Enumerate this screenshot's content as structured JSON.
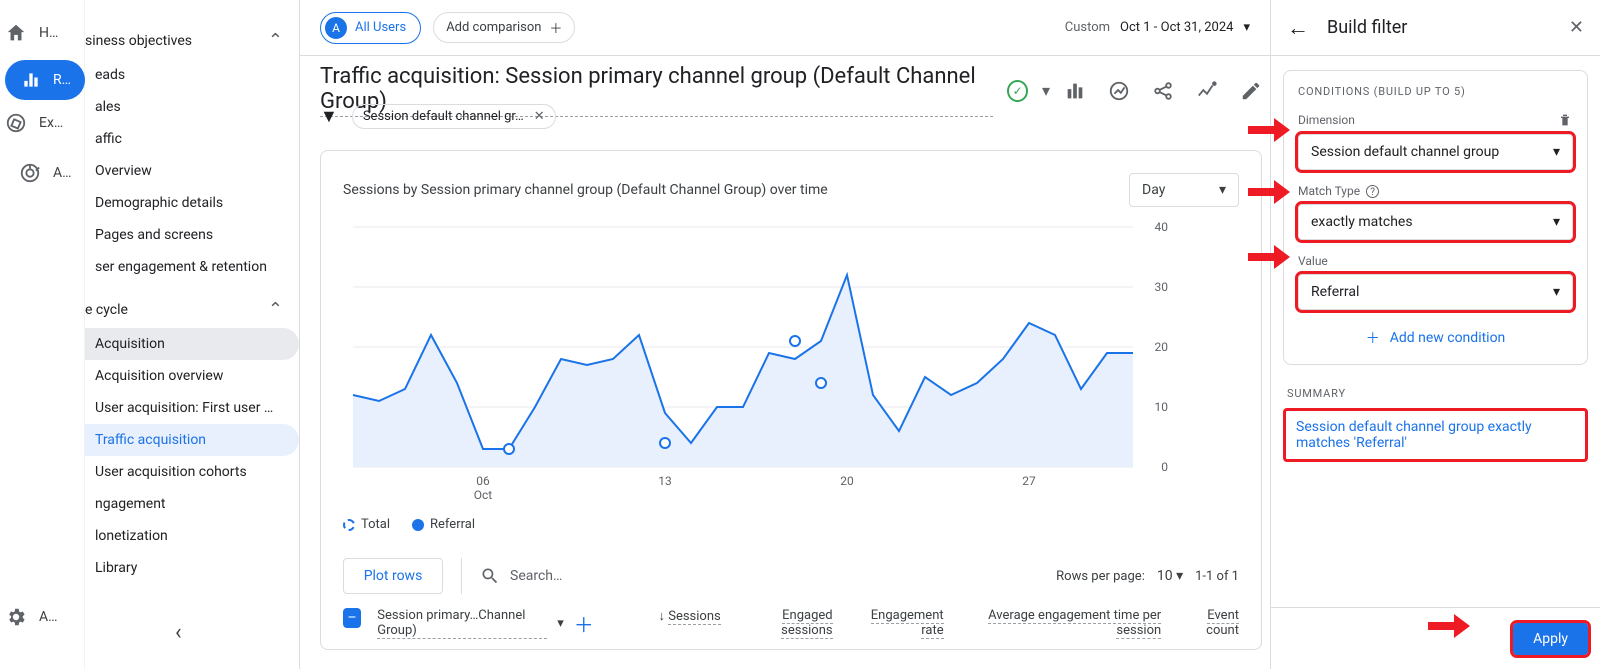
{
  "rail": {
    "home": "H…",
    "reports": "R…",
    "explore": "Ex…",
    "advertising": "A…",
    "admin": "A…"
  },
  "sidenav": {
    "heading": "siness objectives",
    "items": [
      "eads",
      "ales",
      "affic"
    ],
    "traffic_children": [
      "Overview",
      "Demographic details",
      "Pages and screens"
    ],
    "engagement_ret": "ser engagement & retention",
    "cycle": "e cycle",
    "acquisition": "Acquisition",
    "acq_children": [
      "Acquisition overview",
      "User acquisition: First user …",
      "Traffic acquisition",
      "User acquisition cohorts"
    ],
    "bottom": [
      "ngagement",
      "lonetization",
      "Library"
    ]
  },
  "topbar": {
    "allusers": "All Users",
    "addcomp": "Add comparison",
    "custom": "Custom",
    "date": "Oct 1 - Oct 31, 2024"
  },
  "header": {
    "title": "Traffic acquisition: Session primary channel group (Default Channel Group)",
    "chip": "Session default channel gr…"
  },
  "card": {
    "title": "Sessions by Session primary channel group (Default Channel Group) over time",
    "granularity": "Day",
    "legend_total": "Total",
    "legend_referral": "Referral",
    "y_ticks": [
      "40",
      "30",
      "20",
      "10",
      "0"
    ],
    "x_ticks": [
      "06",
      "13",
      "20",
      "27"
    ],
    "x_month": "Oct",
    "plot_rows": "Plot rows",
    "search_ph": "Search…",
    "rpp_label": "Rows per page:",
    "rpp_value": "10",
    "page_label": "1-1 of 1",
    "col_dim": "Session primary…Channel Group)",
    "cols": [
      "Sessions",
      "Engaged sessions",
      "Engagement rate",
      "Average engagement time per session",
      "Event count"
    ]
  },
  "panel": {
    "title": "Build filter",
    "cond_h": "CONDITIONS (BUILD UP TO 5)",
    "dim_l": "Dimension",
    "dim_v": "Session default channel group",
    "mt_l": "Match Type",
    "mt_v": "exactly matches",
    "val_l": "Value",
    "val_v": "Referral",
    "add": "Add new condition",
    "sum_h": "SUMMARY",
    "sum_v": "Session default channel group exactly matches 'Referral'",
    "apply": "Apply"
  },
  "chart_data": {
    "type": "area",
    "xlabel": "Oct",
    "ylabel": "",
    "ylim": [
      0,
      40
    ],
    "x": [
      1,
      2,
      3,
      4,
      5,
      6,
      7,
      8,
      9,
      10,
      11,
      12,
      13,
      14,
      15,
      16,
      17,
      18,
      19,
      20,
      21,
      22,
      23,
      24,
      25,
      26,
      27,
      28,
      29,
      30,
      31
    ],
    "series": [
      {
        "name": "Referral",
        "values": [
          12,
          11,
          13,
          22,
          14,
          3,
          3,
          10,
          18,
          17,
          18,
          22,
          9,
          4,
          10,
          10,
          19,
          18,
          21,
          32,
          12,
          6,
          15,
          12,
          14,
          18,
          24,
          22,
          13,
          19,
          19
        ]
      }
    ],
    "markers": [
      {
        "x": 7,
        "y": 3
      },
      {
        "x": 13,
        "y": 4
      },
      {
        "x": 18,
        "y": 21
      },
      {
        "x": 19,
        "y": 14
      }
    ],
    "x_tick_labels": [
      "06",
      "13",
      "20",
      "27"
    ]
  }
}
